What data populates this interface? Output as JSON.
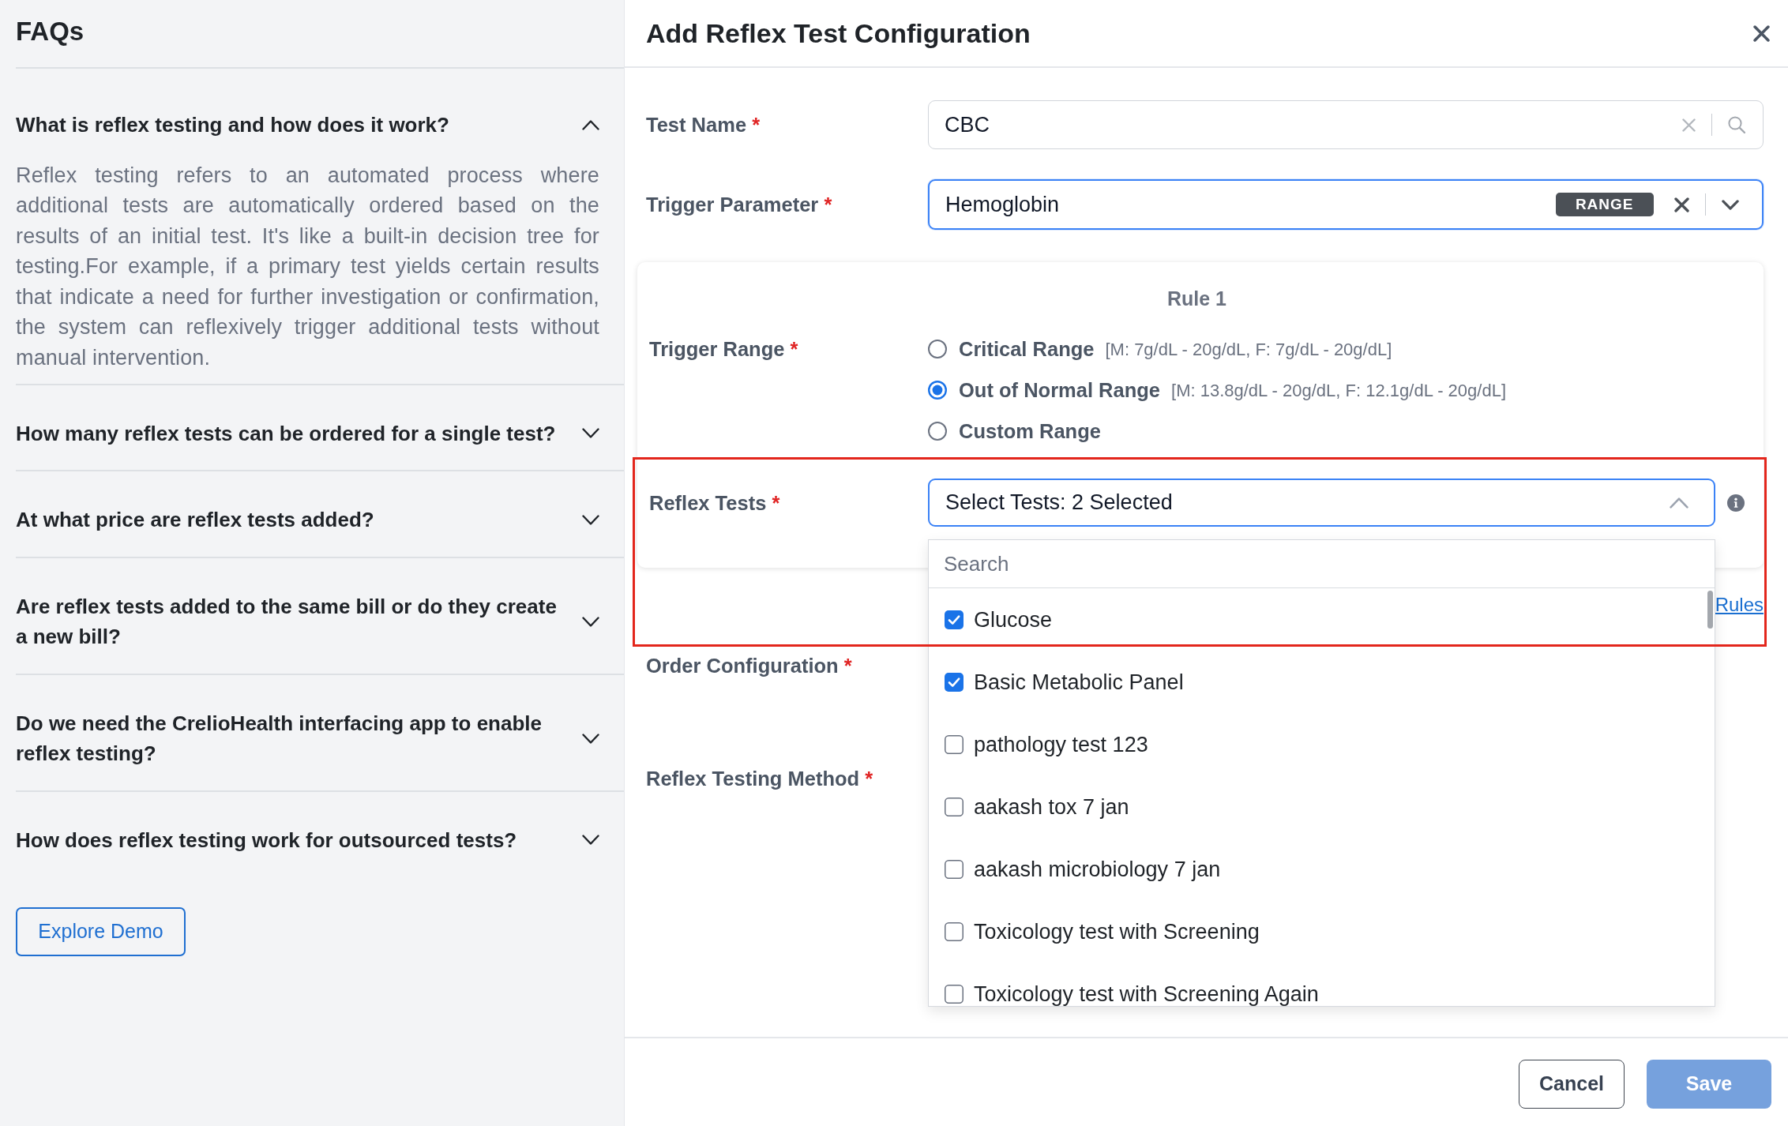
{
  "faq": {
    "title": "FAQs",
    "items": [
      {
        "question": "What is reflex testing and how does it work?",
        "expanded": true,
        "answer": "Reflex testing refers to an automated process where additional tests are automatically ordered based on the results of an initial test. It's like a built-in decision tree for testing.For example, if a primary test yields certain results that indicate a need for further investigation or confirmation, the system can reflexively trigger additional tests without manual intervention."
      },
      {
        "question": "How many reflex tests can be ordered for a single test?",
        "expanded": false
      },
      {
        "question": "At what price are reflex tests added?",
        "expanded": false
      },
      {
        "question": "Are reflex tests added to the same bill or do they create a new bill?",
        "expanded": false
      },
      {
        "question": "Do we need the CrelioHealth interfacing app to enable reflex testing?",
        "expanded": false
      },
      {
        "question": "How does reflex testing work for outsourced tests?",
        "expanded": false
      }
    ],
    "demo_button": "Explore Demo"
  },
  "modal": {
    "title": "Add Reflex Test Configuration",
    "test_name": {
      "label": "Test Name",
      "required_mark": "*",
      "value": "CBC",
      "focused": false
    },
    "trigger_parameter": {
      "label": "Trigger Parameter",
      "required_mark": "*",
      "value": "Hemoglobin",
      "badge": "RANGE",
      "focused": true
    },
    "rule": {
      "title": "Rule 1",
      "trigger_range": {
        "label": "Trigger Range",
        "required_mark": "*",
        "options": [
          {
            "label": "Critical Range",
            "range": "[M: 7g/dL - 20g/dL, F: 7g/dL - 20g/dL]",
            "selected": false
          },
          {
            "label": "Out of Normal Range",
            "range": "[M: 13.8g/dL - 20g/dL, F: 12.1g/dL - 20g/dL]",
            "selected": true
          },
          {
            "label": "Custom Range",
            "selected": false
          }
        ]
      },
      "reflex_tests": {
        "label": "Reflex Tests",
        "required_mark": "*",
        "value": "Select Tests: 2 Selected",
        "expanded": true,
        "highlighted": true,
        "dropdown": {
          "placeholder": "Search",
          "options": [
            {
              "label": "Glucose",
              "checked": true
            },
            {
              "label": "Basic Metabolic Panel",
              "checked": true
            },
            {
              "label": "pathology test 123",
              "checked": false
            },
            {
              "label": "aakash tox 7 jan",
              "checked": false
            },
            {
              "label": "aakash microbiology 7 jan",
              "checked": false
            },
            {
              "label": "Toxicology test with Screening",
              "checked": false
            },
            {
              "label": "Toxicology test with Screening Again",
              "checked": false
            }
          ]
        }
      }
    },
    "rules_link": "Rules",
    "order_configuration": {
      "label": "Order Configuration",
      "required_mark": "*"
    },
    "reflex_testing_method": {
      "label": "Reflex Testing Method",
      "required_mark": "*"
    },
    "buttons": [
      {
        "label": "Cancel",
        "kind": "secondary",
        "disabled": false
      },
      {
        "label": "Save",
        "kind": "primary",
        "disabled": true
      }
    ]
  }
}
